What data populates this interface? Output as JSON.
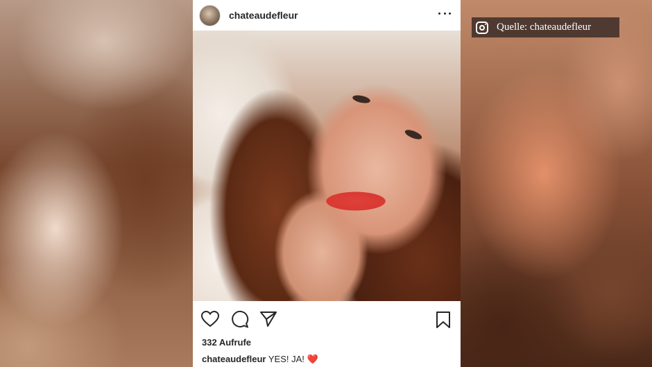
{
  "post": {
    "username": "chateaudefleur",
    "views": "332 Aufrufe",
    "caption_user": "chateaudefleur",
    "caption_text": "YES! JA!",
    "caption_emoji": "❤️"
  },
  "icons": {
    "more": "more-options-icon",
    "like": "heart-icon",
    "comment": "comment-icon",
    "share": "paper-plane-icon",
    "save": "bookmark-icon",
    "source": "instagram-icon"
  },
  "source_label": {
    "text": "Quelle: chateaudefleur"
  },
  "colors": {
    "card_background": "#ffffff",
    "text_primary": "#262626",
    "label_background": "#3c2d28",
    "heart_red": "#e0242f"
  }
}
